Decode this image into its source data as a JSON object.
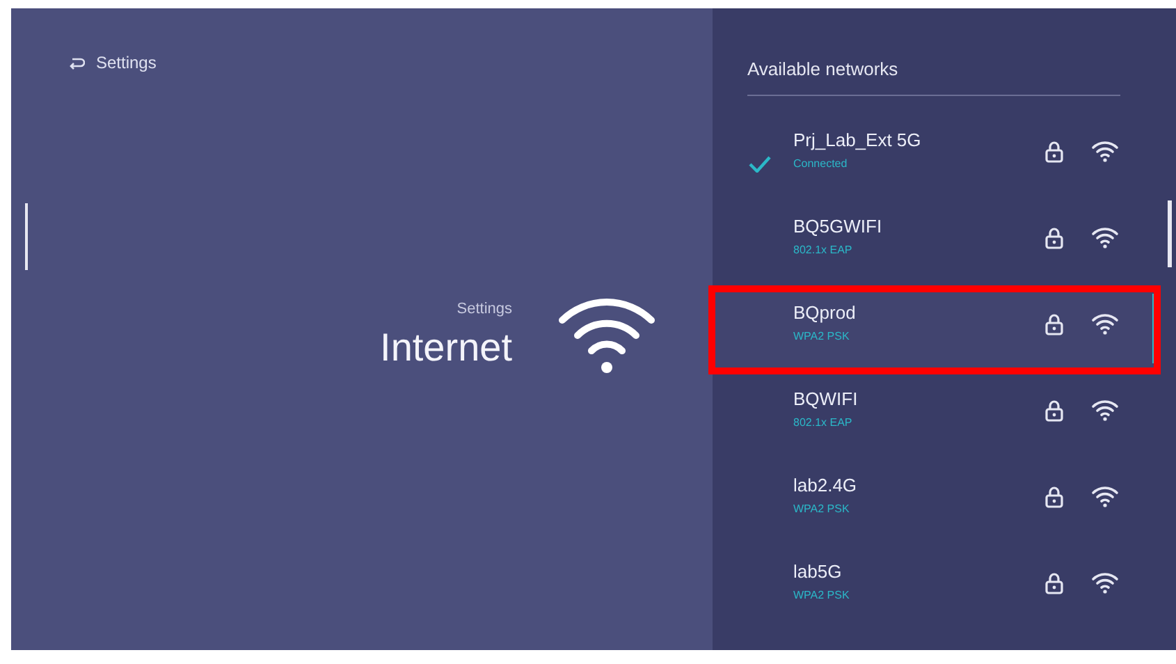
{
  "back": {
    "label": "Settings"
  },
  "title": {
    "caption": "Settings",
    "label": "Internet"
  },
  "networks_header": "Available networks",
  "networks": [
    {
      "name": "Prj_Lab_Ext 5G",
      "detail": "Connected",
      "checked": true,
      "selected": false,
      "highlighted": false
    },
    {
      "name": "BQ5GWIFI",
      "detail": "802.1x EAP",
      "checked": false,
      "selected": false,
      "highlighted": false
    },
    {
      "name": "BQprod",
      "detail": "WPA2 PSK",
      "checked": false,
      "selected": true,
      "highlighted": true
    },
    {
      "name": "BQWIFI",
      "detail": "802.1x EAP",
      "checked": false,
      "selected": false,
      "highlighted": false
    },
    {
      "name": "lab2.4G",
      "detail": "WPA2 PSK",
      "checked": false,
      "selected": false,
      "highlighted": false
    },
    {
      "name": "lab5G",
      "detail": "WPA2 PSK",
      "checked": false,
      "selected": false,
      "highlighted": false
    }
  ]
}
